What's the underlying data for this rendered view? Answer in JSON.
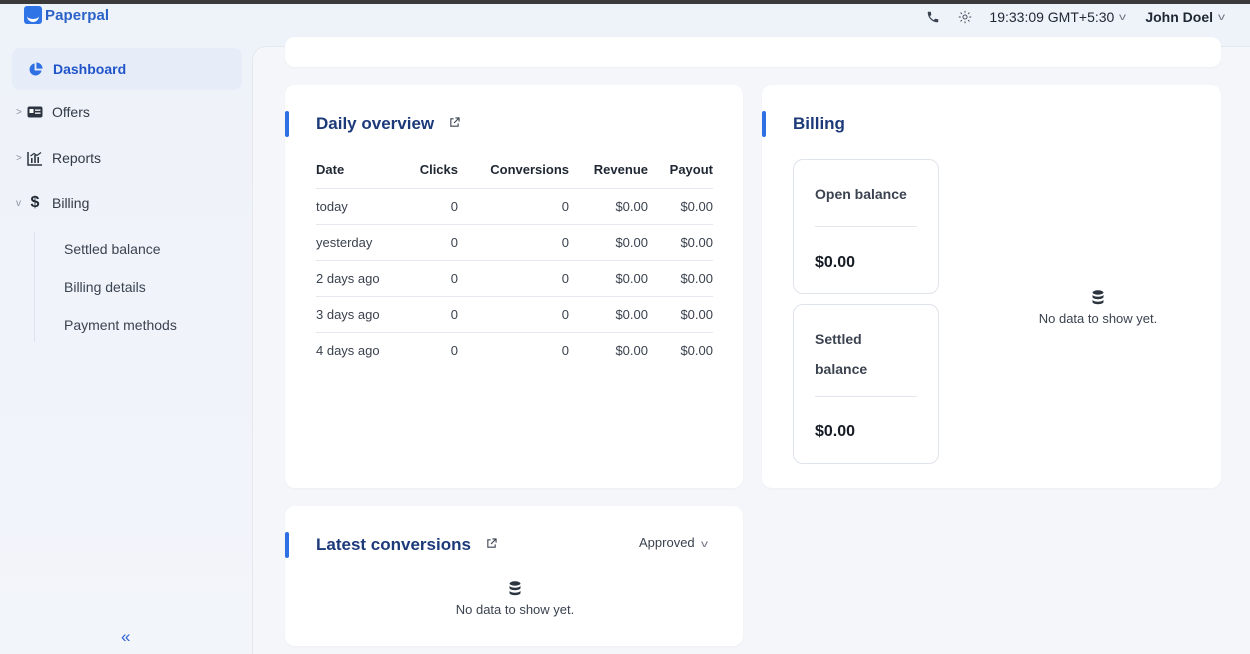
{
  "app": {
    "brand": "Paperpal"
  },
  "header": {
    "time": "19:33:09 GMT+5:30",
    "user": "John Doel",
    "icons": [
      "phone-icon",
      "sun-icon",
      "chevron-down-icon"
    ]
  },
  "sidebar": {
    "items": [
      {
        "label": "Dashboard",
        "icon": "pie-chart-icon",
        "active": true
      },
      {
        "label": "Offers",
        "icon": "id-card-icon"
      },
      {
        "label": "Reports",
        "icon": "bar-chart-icon"
      },
      {
        "label": "Billing",
        "icon": "dollar-icon",
        "expanded": true
      }
    ],
    "billing_sub": [
      "Settled balance",
      "Billing details",
      "Payment methods"
    ],
    "collapse_glyph": "«"
  },
  "daily": {
    "title": "Daily overview",
    "headers": [
      "Date",
      "Clicks",
      "Conversions",
      "Revenue",
      "Payout"
    ],
    "rows": [
      [
        "today",
        "0",
        "0",
        "$0.00",
        "$0.00"
      ],
      [
        "yesterday",
        "0",
        "0",
        "$0.00",
        "$0.00"
      ],
      [
        "2 days ago",
        "0",
        "0",
        "$0.00",
        "$0.00"
      ],
      [
        "3 days ago",
        "0",
        "0",
        "$0.00",
        "$0.00"
      ],
      [
        "4 days ago",
        "0",
        "0",
        "$0.00",
        "$0.00"
      ]
    ]
  },
  "billing": {
    "title": "Billing",
    "open_label": "Open balance",
    "open_value": "$0.00",
    "settled_label_1": "Settled",
    "settled_label_2": "balance",
    "settled_value": "$0.00",
    "no_data": "No data to show yet."
  },
  "latest": {
    "title": "Latest conversions",
    "filter": "Approved",
    "no_data": "No data to show yet."
  },
  "colors": {
    "accent": "#2f6fe4",
    "title": "#1c3a7a",
    "brand": "#2b62c9"
  }
}
